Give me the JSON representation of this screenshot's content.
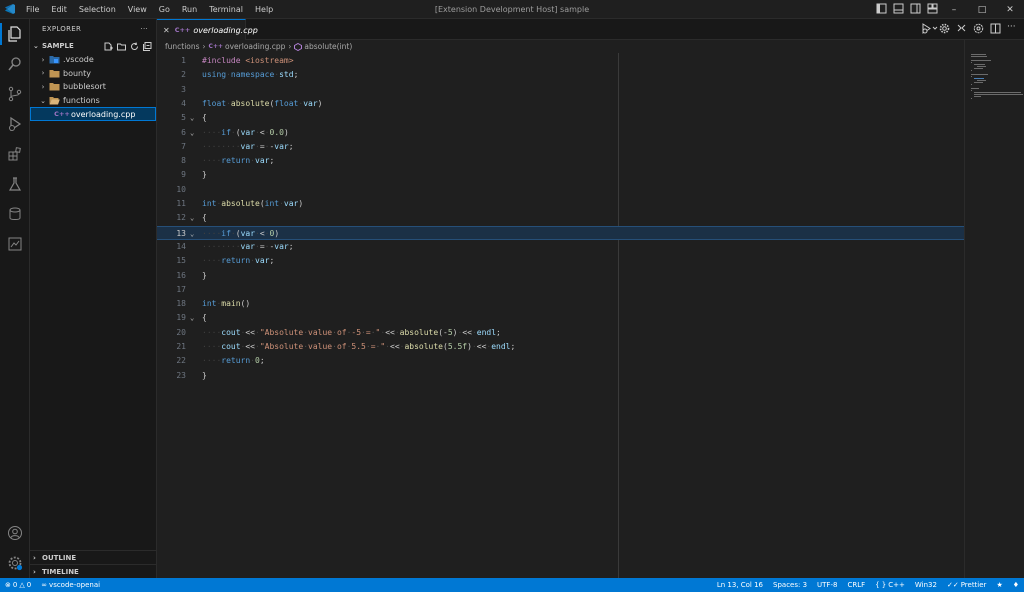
{
  "app": {
    "menu": [
      "File",
      "Edit",
      "Selection",
      "View",
      "Go",
      "Run",
      "Terminal",
      "Help"
    ],
    "window_title": "[Extension Development Host] sample"
  },
  "sidebar": {
    "header": "EXPLORER",
    "more": "···",
    "root": "SAMPLE",
    "tree": [
      {
        "label": ".vscode",
        "type": "folder",
        "expanded": false
      },
      {
        "label": "bounty",
        "type": "folder",
        "expanded": false
      },
      {
        "label": "bubblesort",
        "type": "folder",
        "expanded": false
      },
      {
        "label": "functions",
        "type": "folder",
        "expanded": true
      },
      {
        "label": "overloading.cpp",
        "type": "file",
        "selected": true
      }
    ],
    "outline": "OUTLINE",
    "timeline": "TIMELINE"
  },
  "tab": {
    "icon": "C++",
    "label": "overloading.cpp"
  },
  "breadcrumb": [
    "functions",
    "overloading.cpp",
    "absolute(int)"
  ],
  "editor": {
    "current_line": 13,
    "lines": [
      "#include <iostream>",
      "using namespace std;",
      "",
      "float absolute(float var)",
      "{",
      "    if (var < 0.0)",
      "        var = -var;",
      "    return var;",
      "}",
      "",
      "int absolute(int var)",
      "{",
      "    if (var < 0)",
      "        var = -var;",
      "    return var;",
      "}",
      "",
      "int main()",
      "{",
      "    cout << \"Absolute value of -5 = \" << absolute(-5) << endl;",
      "    cout << \"Absolute value of 5.5 = \" << absolute(5.5f) << endl;",
      "    return 0;",
      "}"
    ],
    "fold_lines": [
      5,
      6,
      12,
      13,
      19
    ]
  },
  "status": {
    "errors": "0",
    "warnings": "0",
    "branch": "vscode-openai",
    "position": "Ln 13, Col 16",
    "spaces": "Spaces: 3",
    "encoding": "UTF-8",
    "eol": "CRLF",
    "language": "C++",
    "platform": "Win32",
    "formatter": "Prettier"
  },
  "colors": {
    "accent": "#0078d4",
    "keyword": "#569cd6",
    "function": "#dcdcaa",
    "string": "#ce9178",
    "number": "#b5cea8",
    "preprocessor": "#c586c0",
    "variable": "#9cdcfe"
  }
}
